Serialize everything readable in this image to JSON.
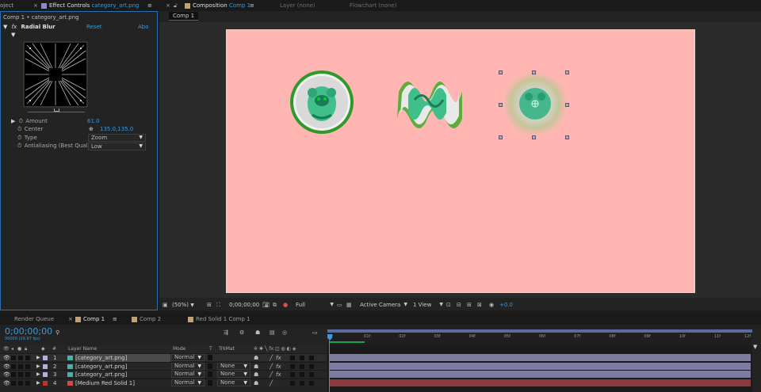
{
  "left_panel": {
    "tab_project_partial": "oject",
    "tab_effect_controls_label": "Effect Controls",
    "tab_effect_controls_file": "category_art.png",
    "breadcrumb": "Comp 1 • category_art.png",
    "effect_name": "Radial Blur",
    "reset_label": "Reset",
    "about_label": "Abo",
    "props": [
      {
        "name": "Amount",
        "value": "61.0"
      },
      {
        "name": "Center",
        "value": "135.0,135.0"
      },
      {
        "name": "Type",
        "value": "Zoom"
      },
      {
        "name": "Antialiasing (Best Quali",
        "value": "Low"
      }
    ]
  },
  "comp_panel": {
    "tab_composition_label": "Composition",
    "tab_composition_name": "Comp 1",
    "tab_layer": "Layer (none)",
    "tab_flowchart": "Flowchart (none)",
    "comp_chip": "Comp 1",
    "canvas_color": "#ffb6b3",
    "footer": {
      "zoom": "(50%)",
      "timecode": "0;00;00;00",
      "resolution": "Full",
      "camera": "Active Camera",
      "views": "1 View",
      "exposure": "+0.0"
    }
  },
  "timeline": {
    "tabs": [
      "Render Queue",
      "Comp 1",
      "Comp 2",
      "Red Solid 1 Comp 1"
    ],
    "timecode": "0;00;00;00",
    "fps": "00000 (29.97 fps)",
    "columns": {
      "num": "#",
      "layer_name": "Layer Name",
      "mode": "Mode",
      "t": "T",
      "trkmat": "TrkMat"
    },
    "ruler": [
      "0f",
      "01f",
      "02f",
      "03f",
      "04f",
      "05f",
      "06f",
      "07f",
      "08f",
      "09f",
      "10f",
      "11f",
      "12f"
    ],
    "layers": [
      {
        "num": "1",
        "name": "[category_art.png]",
        "mode": "Normal",
        "trkmat": "",
        "color": "#b3b1d9"
      },
      {
        "num": "2",
        "name": "[category_art.png]",
        "mode": "Normal",
        "trkmat": "None",
        "color": "#b3b1d9"
      },
      {
        "num": "3",
        "name": "[category_art.png]",
        "mode": "Normal",
        "trkmat": "None",
        "color": "#b3b1d9"
      },
      {
        "num": "4",
        "name": "[Medium Red Solid 1]",
        "mode": "Normal",
        "trkmat": "None",
        "color": "#c0312b"
      }
    ]
  }
}
